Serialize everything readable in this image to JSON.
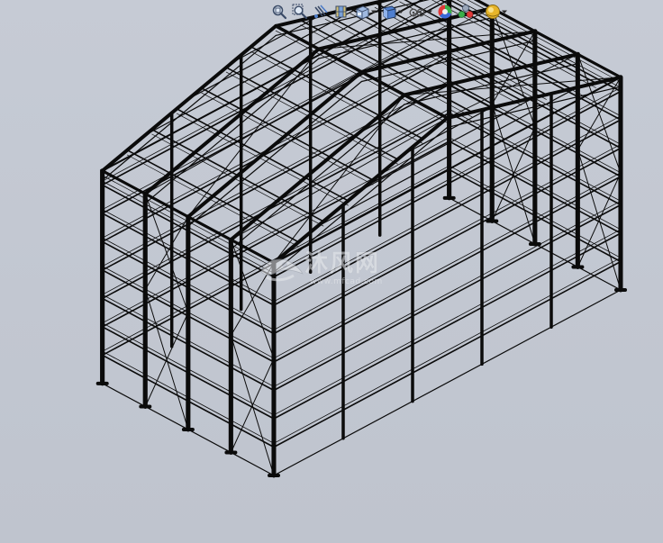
{
  "toolbar": {
    "buttons": [
      {
        "id": "zoom-to-fit",
        "icon": "zoom-to-fit-icon"
      },
      {
        "id": "zoom-to-area",
        "icon": "zoom-to-area-icon"
      },
      {
        "id": "previous-view",
        "icon": "previous-view-icon"
      },
      {
        "id": "section-view",
        "icon": "section-view-icon"
      },
      {
        "id": "view-orientation",
        "icon": "view-orientation-icon",
        "dropdown": true
      },
      {
        "id": "display-style",
        "icon": "display-style-icon",
        "dropdown": true
      },
      {
        "id": "hide-show-items",
        "icon": "hide-show-items-icon",
        "dropdown": true
      },
      {
        "id": "edit-appearance",
        "icon": "edit-appearance-icon"
      },
      {
        "id": "apply-scene",
        "icon": "apply-scene-icon",
        "dropdown": true
      },
      {
        "id": "view-settings",
        "icon": "view-settings-icon",
        "dropdown": true
      }
    ]
  },
  "watermark": {
    "text": "沐风网",
    "url": "www.mfcad.com"
  },
  "colors": {
    "background": "#c4c9d3",
    "model_lines": "#0b0b0b",
    "watermark": "#e8eaee"
  }
}
